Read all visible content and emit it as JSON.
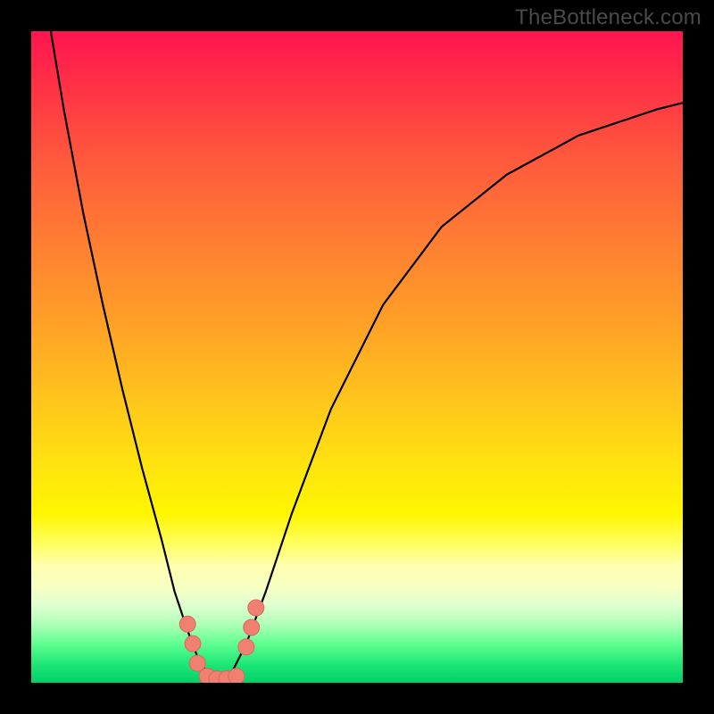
{
  "watermark": "TheBottleneck.com",
  "chart_data": {
    "type": "line",
    "title": "",
    "xlabel": "",
    "ylabel": "",
    "xlim": [
      0,
      100
    ],
    "ylim": [
      0,
      100
    ],
    "series": [
      {
        "name": "bottleneck-curve",
        "x": [
          3,
          5,
          8,
          11,
          14,
          17,
          20,
          22,
          24,
          25.5,
          27,
          28,
          29,
          30,
          31,
          33,
          36,
          40,
          46,
          54,
          63,
          73,
          84,
          96,
          100
        ],
        "values": [
          100,
          88,
          72,
          58,
          45,
          33,
          22,
          14,
          8,
          4,
          1.5,
          0.6,
          0.3,
          0.6,
          2,
          6,
          14,
          26,
          42,
          58,
          70,
          78,
          84,
          88,
          89
        ]
      }
    ],
    "markers": [
      {
        "name": "marker-cluster-left",
        "x": 24.0,
        "y": 9.0
      },
      {
        "name": "marker-cluster-left",
        "x": 24.8,
        "y": 6.0
      },
      {
        "name": "marker-cluster-left",
        "x": 25.5,
        "y": 3.0
      },
      {
        "name": "marker-cluster-bottom",
        "x": 27.0,
        "y": 1.0
      },
      {
        "name": "marker-cluster-bottom",
        "x": 28.5,
        "y": 0.6
      },
      {
        "name": "marker-cluster-bottom",
        "x": 30.0,
        "y": 0.6
      },
      {
        "name": "marker-cluster-bottom",
        "x": 31.5,
        "y": 1.0
      },
      {
        "name": "marker-cluster-right",
        "x": 33.0,
        "y": 5.5
      },
      {
        "name": "marker-cluster-right",
        "x": 33.8,
        "y": 8.5
      },
      {
        "name": "marker-cluster-right",
        "x": 34.5,
        "y": 11.5
      }
    ],
    "colors": {
      "curve": "#000000",
      "marker_fill": "#f08070",
      "marker_stroke": "#d86a5e"
    }
  }
}
